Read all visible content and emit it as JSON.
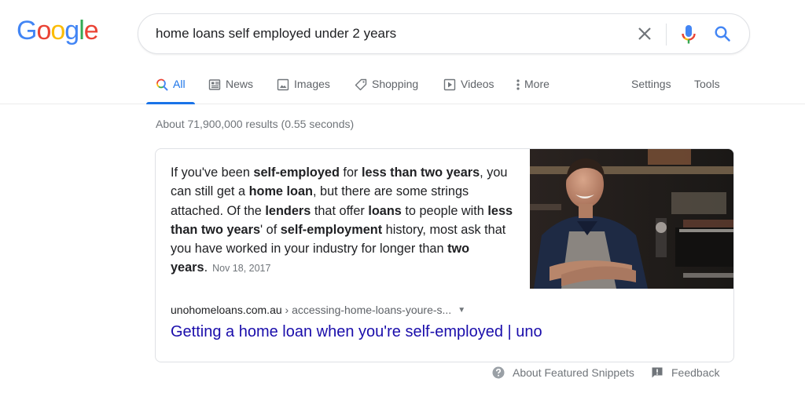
{
  "logo": {
    "letters": [
      {
        "char": "G",
        "color": "#4285f4"
      },
      {
        "char": "o",
        "color": "#ea4335"
      },
      {
        "char": "o",
        "color": "#fbbc05"
      },
      {
        "char": "g",
        "color": "#4285f4"
      },
      {
        "char": "l",
        "color": "#34a853"
      },
      {
        "char": "e",
        "color": "#ea4335"
      }
    ]
  },
  "search": {
    "query": "home loans self employed under 2 years",
    "clear_icon": "close-icon",
    "mic_icon": "microphone-icon",
    "search_icon": "search-icon"
  },
  "tabs": [
    {
      "label": "All",
      "icon": "search-icon",
      "active": true
    },
    {
      "label": "News",
      "icon": "newspaper-icon",
      "active": false
    },
    {
      "label": "Images",
      "icon": "image-icon",
      "active": false
    },
    {
      "label": "Shopping",
      "icon": "tag-icon",
      "active": false
    },
    {
      "label": "Videos",
      "icon": "play-icon",
      "active": false
    },
    {
      "label": "More",
      "icon": "more-vert-icon",
      "active": false
    }
  ],
  "tools": {
    "settings_label": "Settings",
    "tools_label": "Tools"
  },
  "result_stats": "About 71,900,000 results (0.55 seconds)",
  "featured_snippet": {
    "segments": [
      {
        "text": "If you've been ",
        "bold": false
      },
      {
        "text": "self-employed",
        "bold": true
      },
      {
        "text": " for ",
        "bold": false
      },
      {
        "text": "less than two years",
        "bold": true
      },
      {
        "text": ", you can still get a ",
        "bold": false
      },
      {
        "text": "home loan",
        "bold": true
      },
      {
        "text": ", but there are some strings attached. Of the ",
        "bold": false
      },
      {
        "text": "lenders",
        "bold": true
      },
      {
        "text": " that offer ",
        "bold": false
      },
      {
        "text": "loans",
        "bold": true
      },
      {
        "text": " to people with ",
        "bold": false
      },
      {
        "text": "less than two years",
        "bold": true
      },
      {
        "text": "' of ",
        "bold": false
      },
      {
        "text": "self-employment",
        "bold": true
      },
      {
        "text": " history, most ask that you have worked in your industry for longer than ",
        "bold": false
      },
      {
        "text": "two years",
        "bold": true
      },
      {
        "text": ".",
        "bold": false
      }
    ],
    "date": "Nov 18, 2017",
    "image_alt": "Smiling man in apron with arms crossed in a cafe",
    "source_domain": "unohomeloans.com.au",
    "source_path": " › accessing-home-loans-youre-s...",
    "title": "Getting a home loan when you're self-employed | uno",
    "link_color": "#1a0dab"
  },
  "footer": {
    "about_label": "About Featured Snippets",
    "feedback_label": "Feedback"
  }
}
